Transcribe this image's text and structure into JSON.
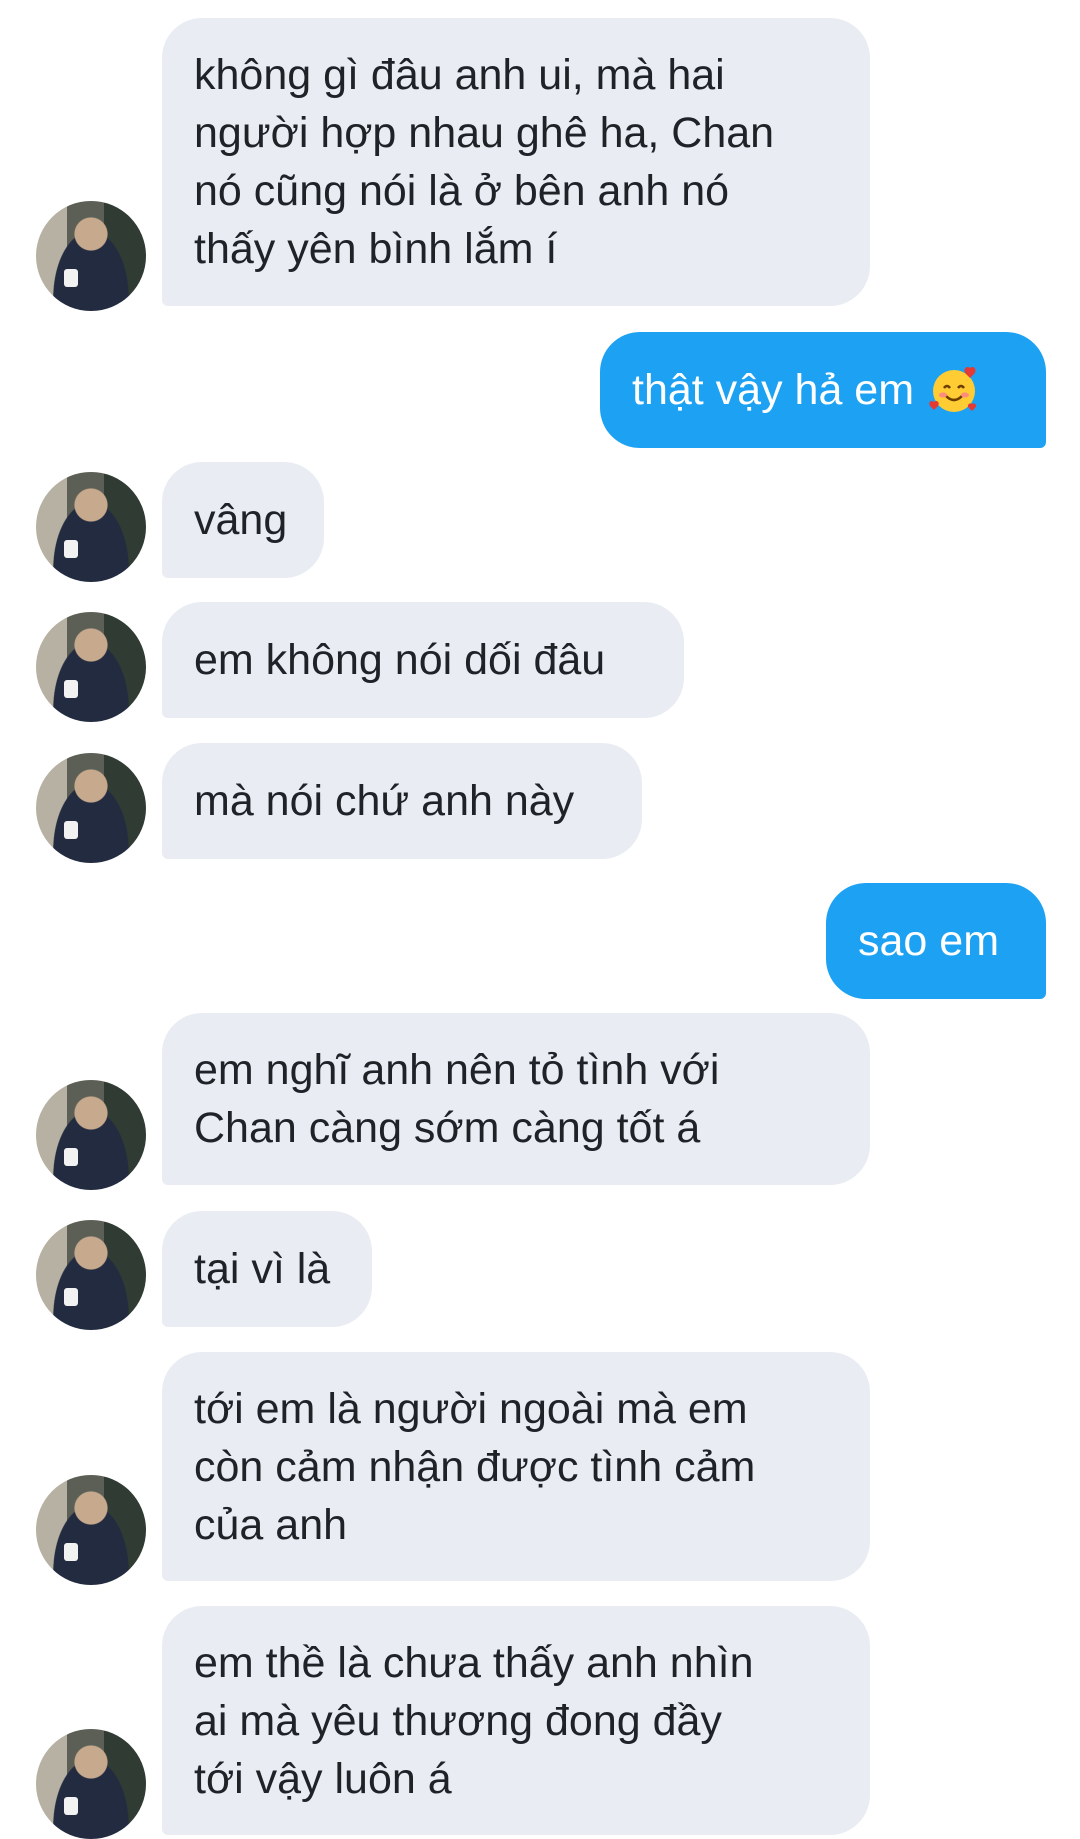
{
  "messages": [
    {
      "id": "m1",
      "sender": "them",
      "text": "không gì đâu anh ui, mà hai\nngười hợp nhau ghê ha, Chan\nnó cũng nói là ở bên anh nó\nthấy yên bình lắm í"
    },
    {
      "id": "m2",
      "sender": "me",
      "text": "thật vậy hả em",
      "emoji": "smiling-face-with-hearts-icon"
    },
    {
      "id": "m3",
      "sender": "them",
      "text": "vâng"
    },
    {
      "id": "m4",
      "sender": "them",
      "text": "em không nói dối đâu"
    },
    {
      "id": "m5",
      "sender": "them",
      "text": "mà nói chứ anh này"
    },
    {
      "id": "m6",
      "sender": "me",
      "text": "sao em"
    },
    {
      "id": "m7",
      "sender": "them",
      "text": "em nghĩ anh nên tỏ tình với\nChan càng sớm càng tốt á"
    },
    {
      "id": "m8",
      "sender": "them",
      "text": "tại vì là"
    },
    {
      "id": "m9",
      "sender": "them",
      "text": "tới em là người ngoài mà em\ncòn cảm nhận được tình cảm\ncủa anh"
    },
    {
      "id": "m10",
      "sender": "them",
      "text": "em thề là chưa thấy anh nhìn\nai mà yêu thương đong đầy\ntới vậy luôn á"
    }
  ],
  "colors": {
    "incoming_bubble": "#e9ecf2",
    "outgoing_bubble": "#1da1f2",
    "incoming_text": "#1f2328",
    "outgoing_text": "#ffffff"
  }
}
